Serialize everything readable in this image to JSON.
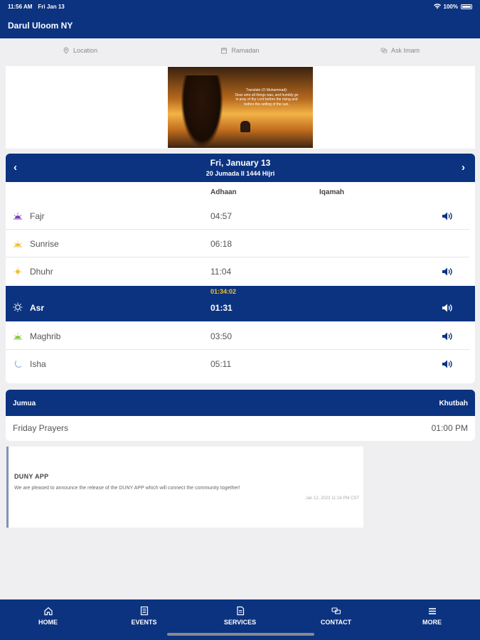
{
  "status_bar": {
    "time": "11:56 AM",
    "date": "Fri Jan 13",
    "battery": "100%"
  },
  "app": {
    "title": "Darul Uloom NY"
  },
  "top_links": [
    {
      "label": "Location",
      "icon": "location-pin-icon"
    },
    {
      "label": "Ramadan",
      "icon": "calendar-icon"
    },
    {
      "label": "Ask Imam",
      "icon": "chat-bubbles-icon"
    }
  ],
  "banner": {
    "quote_lines": [
      "Translate (O Muhammad):",
      "Dear unto all things was, and humbly go",
      "in pray of thy Lord before the rising and",
      "before the setting of the sun."
    ]
  },
  "prayer_times": {
    "gregorian_date": "Fri, January 13",
    "hijri_date": "20 Jumada II 1444 Hijri",
    "prev_symbol": "‹",
    "next_symbol": "›",
    "columns": {
      "adhaan": "Adhaan",
      "iqamah": "Iqamah"
    },
    "countdown": "01:34:02",
    "rows": [
      {
        "name": "Fajr",
        "adhaan": "04:57",
        "iqamah": "",
        "icon": "fajr-dawn-icon",
        "has_sound": true,
        "active": false
      },
      {
        "name": "Sunrise",
        "adhaan": "06:18",
        "iqamah": "",
        "icon": "sunrise-icon",
        "has_sound": false,
        "active": false
      },
      {
        "name": "Dhuhr",
        "adhaan": "11:04",
        "iqamah": "",
        "icon": "sun-icon",
        "has_sound": true,
        "active": false
      },
      {
        "name": "Asr",
        "adhaan": "01:31",
        "iqamah": "",
        "icon": "sun-outline-icon",
        "has_sound": true,
        "active": true
      },
      {
        "name": "Maghrib",
        "adhaan": "03:50",
        "iqamah": "",
        "icon": "sunset-icon",
        "has_sound": true,
        "active": false
      },
      {
        "name": "Isha",
        "adhaan": "05:11",
        "iqamah": "",
        "icon": "moon-icon",
        "has_sound": true,
        "active": false
      }
    ]
  },
  "jumua": {
    "header_left": "Jumua",
    "header_right": "Khutbah",
    "row_label": "Friday Prayers",
    "row_time": "01:00 PM"
  },
  "news": {
    "title": "DUNY APP",
    "body": "We are pleased to announce the release of the DUNY APP which will connect the community together!",
    "date": "Jan 12, 2023 11:16 PM CST"
  },
  "bottom_nav": [
    {
      "label": "HOME",
      "icon": "home-icon"
    },
    {
      "label": "EVENTS",
      "icon": "events-icon"
    },
    {
      "label": "SERVICES",
      "icon": "services-icon"
    },
    {
      "label": "CONTACT",
      "icon": "contact-icon"
    },
    {
      "label": "MORE",
      "icon": "menu-icon"
    }
  ],
  "colors": {
    "primary": "#0c3380",
    "countdown": "#f5c518",
    "background": "#efeff1"
  }
}
